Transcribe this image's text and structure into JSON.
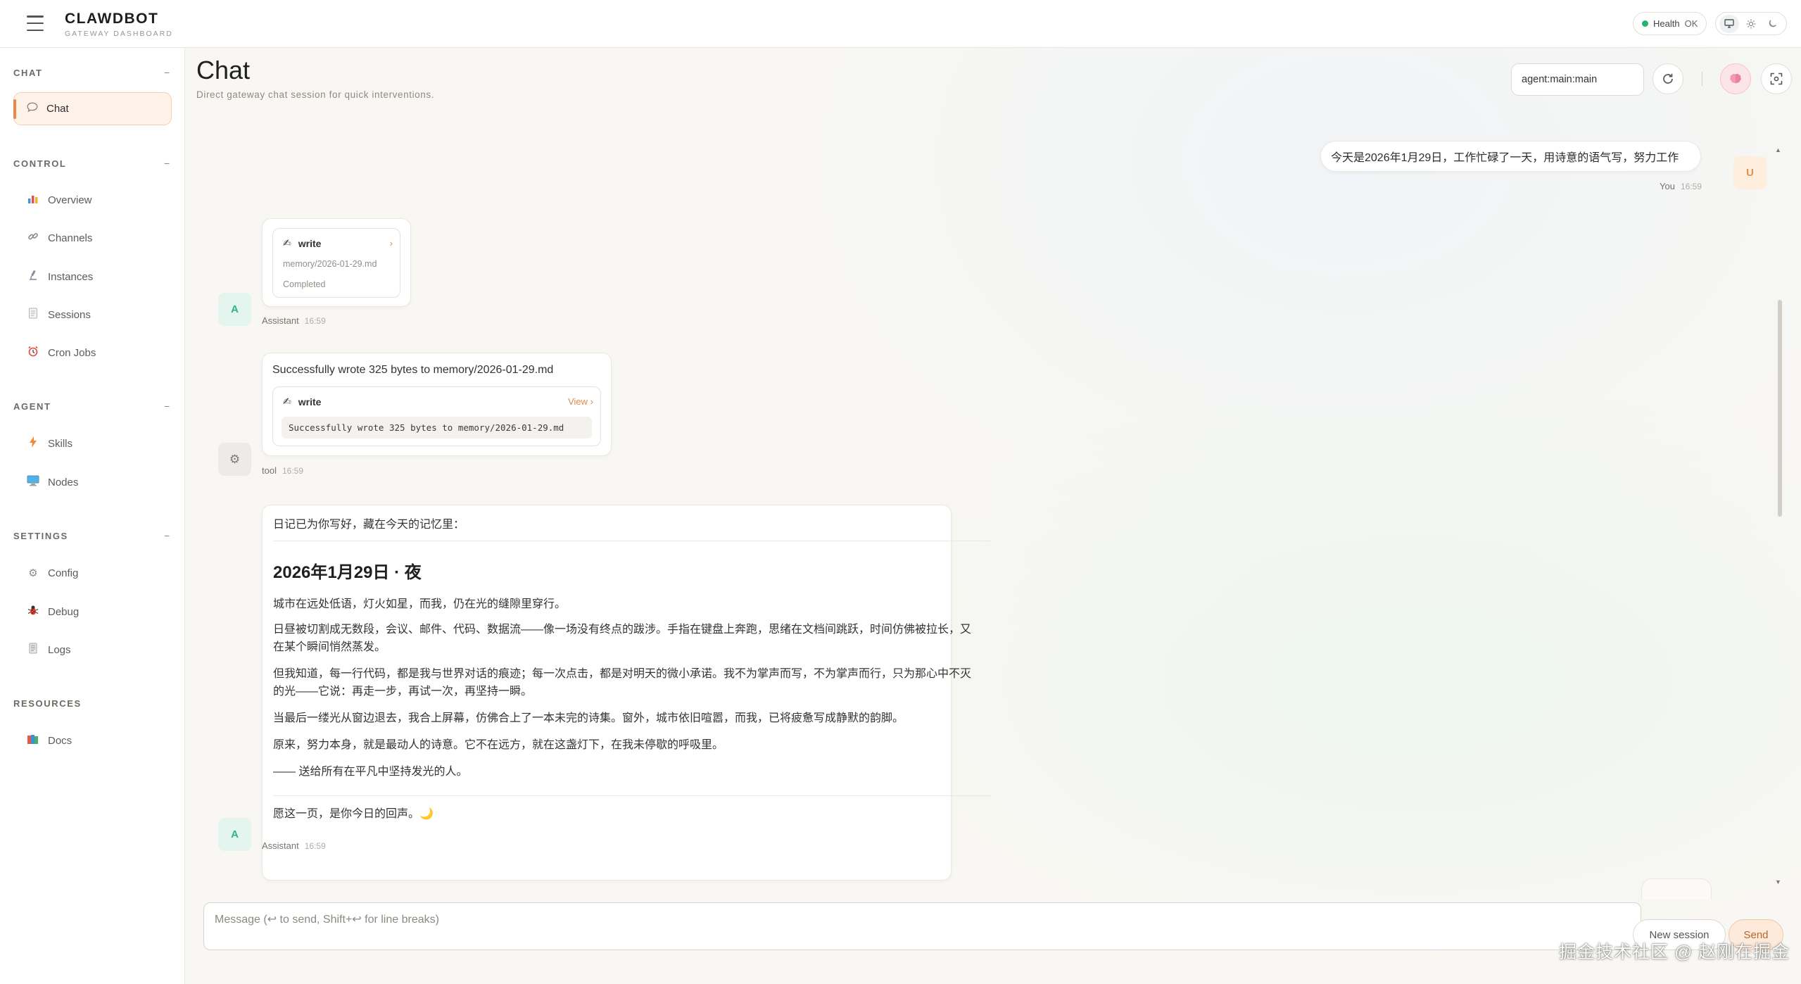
{
  "app": {
    "brand_name": "CLAWDBOT",
    "brand_sub": "GATEWAY DASHBOARD"
  },
  "topbar": {
    "health_label": "Health",
    "health_value": "OK",
    "theme_icons": [
      "monitor-icon",
      "sun-icon",
      "moon-icon"
    ]
  },
  "sidebar": {
    "sections": [
      {
        "title": "CHAT",
        "items": [
          {
            "label": "Chat",
            "icon": "chat-bubble-icon",
            "active": true
          }
        ]
      },
      {
        "title": "CONTROL",
        "items": [
          {
            "label": "Overview",
            "icon": "bar-chart-icon"
          },
          {
            "label": "Channels",
            "icon": "link-icon"
          },
          {
            "label": "Instances",
            "icon": "microscope-icon"
          },
          {
            "label": "Sessions",
            "icon": "document-icon"
          },
          {
            "label": "Cron Jobs",
            "icon": "alarm-clock-icon"
          }
        ]
      },
      {
        "title": "AGENT",
        "items": [
          {
            "label": "Skills",
            "icon": "lightning-icon"
          },
          {
            "label": "Nodes",
            "icon": "computer-icon"
          }
        ]
      },
      {
        "title": "SETTINGS",
        "items": [
          {
            "label": "Config",
            "icon": "gear-icon"
          },
          {
            "label": "Debug",
            "icon": "bug-icon"
          },
          {
            "label": "Logs",
            "icon": "log-scroll-icon"
          }
        ]
      },
      {
        "title": "RESOURCES",
        "items": [
          {
            "label": "Docs",
            "icon": "books-icon"
          }
        ]
      }
    ],
    "collapse_glyph": "−"
  },
  "main": {
    "title": "Chat",
    "subtitle": "Direct gateway chat session for quick interventions.",
    "session_key": "agent:main:main",
    "controls": [
      "refresh-icon",
      "brain-icon",
      "focus-icon"
    ]
  },
  "messages": [
    {
      "role": "user",
      "author": "You",
      "avatar": "U",
      "time": "16:59",
      "text": "今天是2026年1月29日，工作忙碌了一天，用诗意的语气写，努力工作"
    },
    {
      "role": "assistant",
      "author": "Assistant",
      "avatar": "A",
      "time": "16:59",
      "tool": {
        "name": "write",
        "path": "memory/2026-01-29.md",
        "status": "Completed",
        "chevron": "›"
      }
    },
    {
      "role": "tool",
      "author": "tool",
      "avatar": "⚙",
      "time": "16:59",
      "text": "Successfully wrote 325 bytes to memory/2026-01-29.md",
      "tool": {
        "name": "write",
        "view_label": "View ›",
        "output": "Successfully wrote 325 bytes to memory/2026-01-29.md"
      }
    },
    {
      "role": "assistant",
      "author": "Assistant",
      "avatar": "A",
      "time": "16:59",
      "intro": "日记已为你写好，藏在今天的记忆里：",
      "poem_title": "2026年1月29日 · 夜",
      "paragraphs": [
        "城市在远处低语，灯火如星，而我，仍在光的缝隙里穿行。",
        "日昼被切割成无数段，会议、邮件、代码、数据流——像一场没有终点的跋涉。手指在键盘上奔跑，思绪在文档间跳跃，时间仿佛被拉长，又在某个瞬间悄然蒸发。",
        "但我知道，每一行代码，都是我与世界对话的痕迹；每一次点击，都是对明天的微小承诺。我不为掌声而写，不为掌声而行，只为那心中不灭的光——它说：再走一步，再试一次，再坚持一瞬。",
        "当最后一缕光从窗边退去，我合上屏幕，仿佛合上了一本未完的诗集。窗外，城市依旧喧嚣，而我，已将疲惫写成静默的韵脚。",
        "原来，努力本身，就是最动人的诗意。它不在远方，就在这盏灯下，在我未停歇的呼吸里。",
        "—— 送给所有在平凡中坚持发光的人。"
      ],
      "closing": "愿这一页，是你今日的回声。🌙"
    }
  ],
  "composer": {
    "placeholder": "Message (↩ to send, Shift+↩ for line breaks)",
    "new_session_label": "New session",
    "send_label": "Send"
  },
  "watermark": "掘金技术社区 @ 赵刚在掘金"
}
